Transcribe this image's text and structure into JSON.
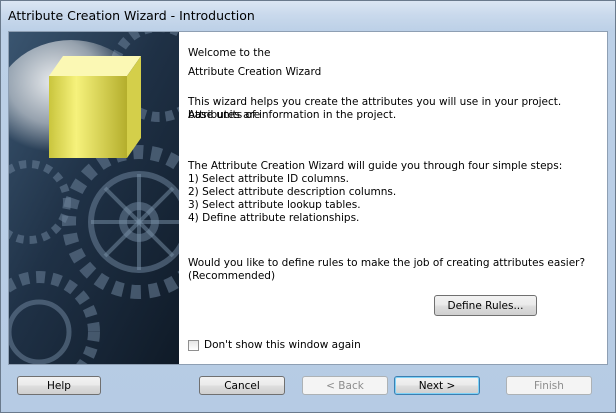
{
  "window": {
    "title": "Attribute Creation Wizard - Introduction"
  },
  "intro": {
    "welcome_line1": "Welcome to the",
    "welcome_line2": "Attribute Creation Wizard",
    "description_line1": "This wizard helps you create the attributes you will use in your project. Attributes are",
    "description_line2": "base units of information in the project.",
    "steps_intro": "The Attribute Creation Wizard will guide you through four simple steps:",
    "steps": [
      "1) Select attribute ID columns.",
      "2) Select attribute description columns.",
      "3) Select attribute lookup tables.",
      "4) Define attribute relationships."
    ],
    "question_line1": "Would you like to define rules to make the job of creating attributes easier?",
    "question_line2": "(Recommended)",
    "define_rules_label": "Define Rules...",
    "dont_show_label": "Don't show this window again",
    "dont_show_checked": false
  },
  "footer": {
    "help_label": "Help",
    "cancel_label": "Cancel",
    "back_label": "< Back",
    "next_label": "Next >",
    "finish_label": "Finish"
  },
  "colors": {
    "window_frame": "#b6cbe4",
    "banner_dark": "#1b2a3c",
    "cube": "#f2ee7a"
  }
}
